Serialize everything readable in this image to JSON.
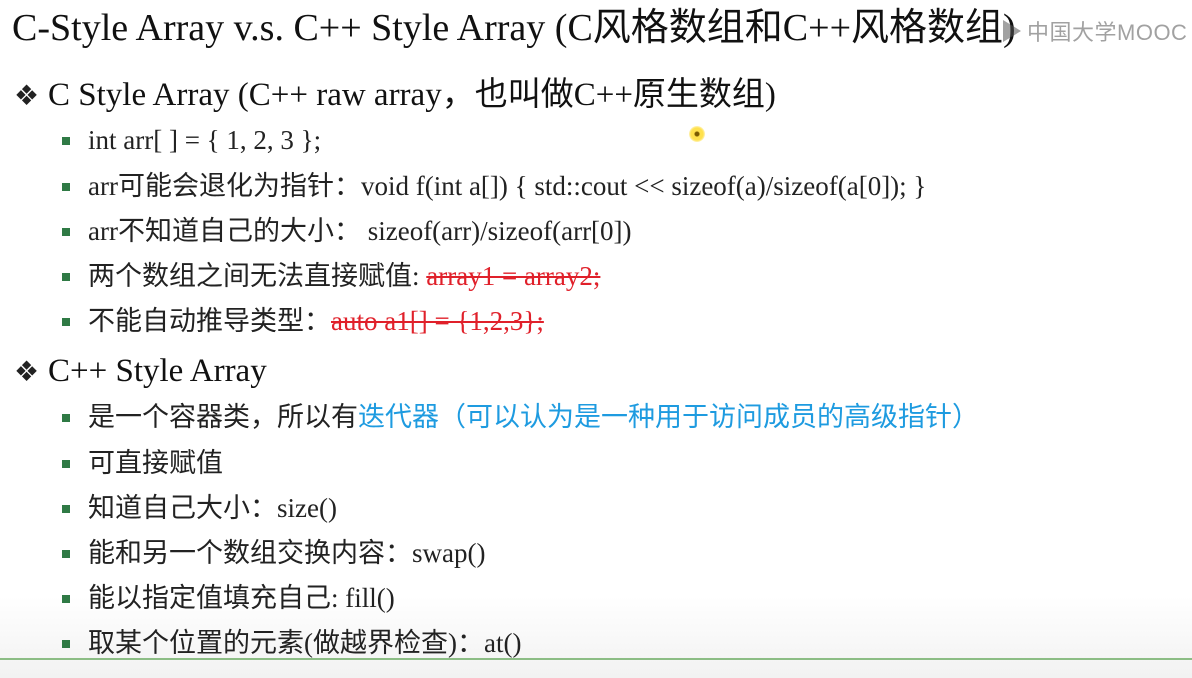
{
  "slide": {
    "title": "C-Style Array v.s. C++ Style Array (C风格数组和C++风格数组)",
    "watermark": "中国大学MOOC",
    "sections": [
      {
        "heading": "C Style Array (C++ raw array，也叫做C++原生数组)",
        "items": [
          {
            "text": "int arr[ ] = { 1, 2, 3 };"
          },
          {
            "text": "arr可能会退化为指针：void f(int a[]) { std::cout << sizeof(a)/sizeof(a[0]); }"
          },
          {
            "text": "arr不知道自己的大小： sizeof(arr)/sizeof(arr[0])"
          },
          {
            "text": "两个数组之间无法直接赋值: ",
            "struck": "array1 = array2;"
          },
          {
            "text": "不能自动推导类型：",
            "struck": "auto a1[] = {1,2,3};"
          }
        ]
      },
      {
        "heading": "C++ Style Array",
        "items": [
          {
            "text": "是一个容器类，所以有",
            "highlight": "迭代器（可以认为是一种用于访问成员的高级指针）"
          },
          {
            "text": "可直接赋值"
          },
          {
            "text": "知道自己大小：size()"
          },
          {
            "text": "能和另一个数组交换内容：swap()"
          },
          {
            "text": "能以指定值填充自己: fill()"
          },
          {
            "text": "取某个位置的元素(做越界检查)：at()"
          }
        ]
      }
    ],
    "colors": {
      "bullet": "#2f7a45",
      "strike": "#e0202a",
      "highlight": "#1e9be0",
      "bottom_line": "#8cbd85"
    },
    "icons": {
      "section_marker": "diamond-bullet-icon",
      "item_marker": "square-bullet-icon",
      "watermark_marker": "play-icon",
      "pointer": "laser-pointer-dot"
    }
  }
}
